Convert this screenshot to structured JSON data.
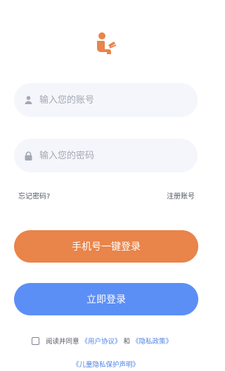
{
  "brand": {
    "logo_icon": "reading-person-icon",
    "accent_color": "#e9844a"
  },
  "form": {
    "account_placeholder": "输入您的账号",
    "account_icon": "user-icon",
    "password_placeholder": "输入您的密码",
    "password_icon": "lock-icon"
  },
  "links": {
    "forgot_password": "忘记密码?",
    "register": "注册账号"
  },
  "buttons": {
    "one_click_login": "手机号一键登录",
    "one_click_color": "#e9844a",
    "login": "立即登录",
    "login_color": "#5b8ff5"
  },
  "agreement": {
    "prefix": "阅读并同意",
    "user_agreement": "《用户协议》",
    "and": "和",
    "privacy_policy": "《隐私政策》",
    "child_privacy": "《儿童隐私保护声明》",
    "link_color": "#4f84e8"
  }
}
